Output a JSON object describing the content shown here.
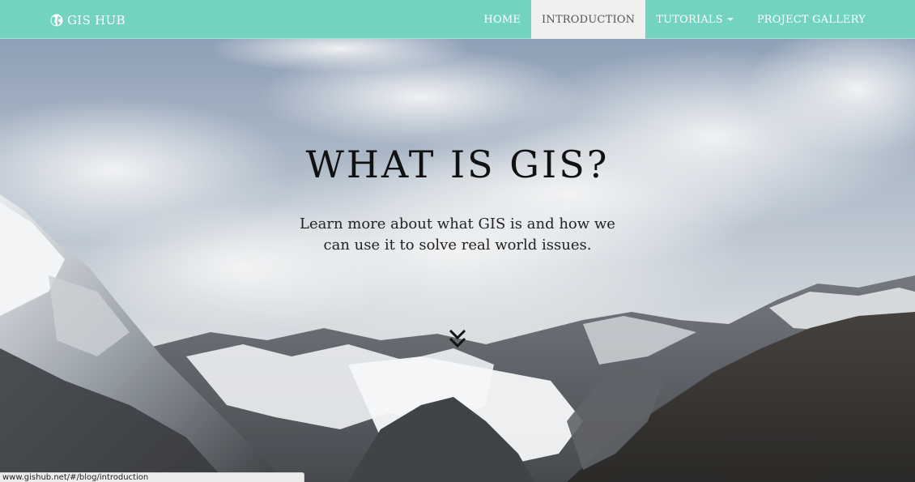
{
  "navbar": {
    "brand": "GIS HUB",
    "brand_icon": "globe-icon",
    "items": [
      {
        "label": "HOME",
        "active": false
      },
      {
        "label": "INTRODUCTION",
        "active": true
      },
      {
        "label": "TUTORIALS",
        "active": false,
        "dropdown": true
      },
      {
        "label": "PROJECT GALLERY",
        "active": false
      }
    ]
  },
  "hero": {
    "title": "WHAT IS GIS?",
    "subtitle": "Learn more about what GIS is and how we can use it to solve real world issues.",
    "scroll_icon": "double-chevron-down-icon"
  },
  "status_bar": {
    "url": "www.gishub.net/#/blog/introduction"
  },
  "colors": {
    "navbar": "#72d3c1",
    "active_tab": "#f0f0f0",
    "title_text": "#111111"
  }
}
